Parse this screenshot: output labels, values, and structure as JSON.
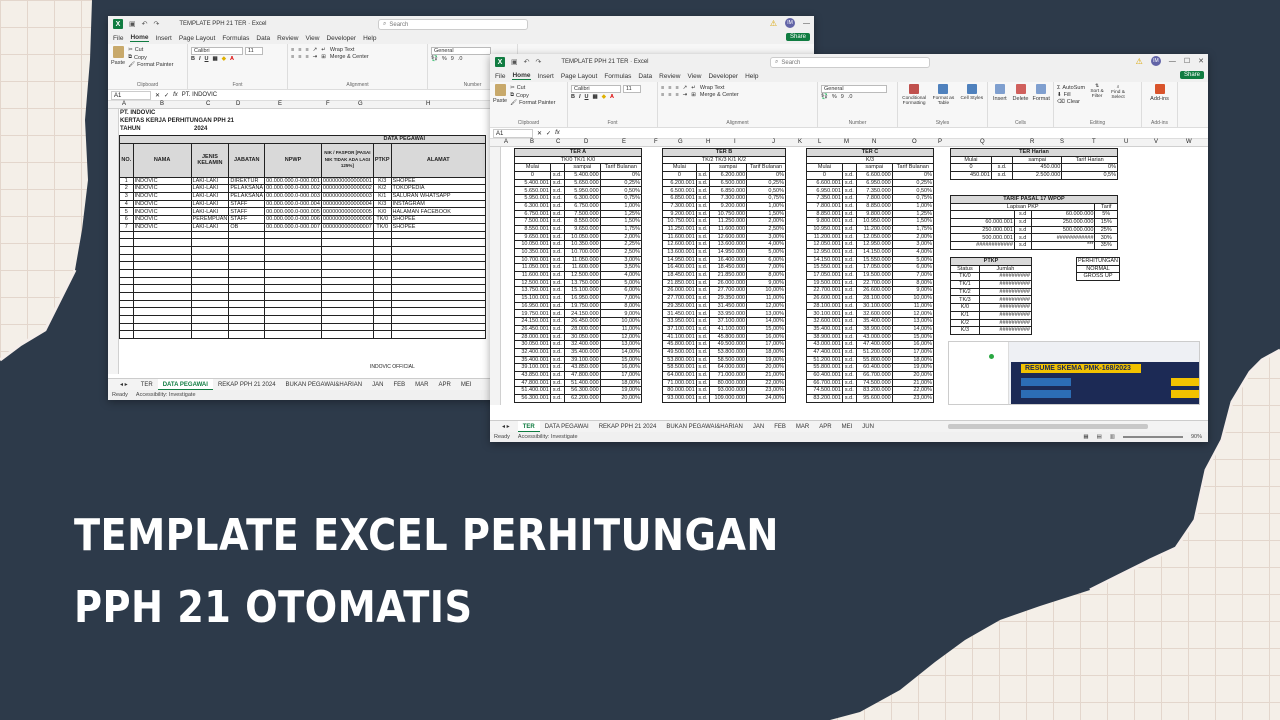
{
  "headline": {
    "line1": "TEMPLATE EXCEL PERHITUNGAN",
    "line2": "PPH 21 OTOMATIS"
  },
  "back_window": {
    "title": "TEMPLATE PPH 21 TER  ·  Excel",
    "search_placeholder": "Search",
    "menu": [
      "File",
      "Home",
      "Insert",
      "Page Layout",
      "Formulas",
      "Data",
      "Review",
      "View",
      "Developer",
      "Help"
    ],
    "share": "Share",
    "font_name": "Calibri",
    "font_size": "11",
    "number_format": "General",
    "clipboard": {
      "cut": "Cut",
      "copy": "Copy",
      "format_painter": "Format Painter",
      "paste": "Paste",
      "label": "Clipboard"
    },
    "wrap_text": "Wrap Text",
    "merge_center": "Merge & Center",
    "group_font": "Font",
    "group_alignment": "Alignment",
    "group_number": "Number",
    "name_box": "A1",
    "formula": "PT. INDOVIC",
    "cols": [
      "A",
      "B",
      "C",
      "D",
      "E",
      "F",
      "G",
      "H"
    ],
    "company": "PT. INDOVIC",
    "sheet_title": "KERTAS KERJA PERHITUNGAN PPH 21",
    "tahun_label": "TAHUN",
    "tahun_value": "2024",
    "data_pegawai": "DATA PEGAWAI",
    "headers": [
      "NO.",
      "NAMA",
      "JENIS KELAMIN",
      "JABATAN",
      "NPWP",
      "NIK / PASPOR [PASAI NIK TIDAK ADA LAGI 125%]",
      "PTKP",
      "ALAMAT"
    ],
    "rows": [
      [
        "1",
        "INDOVIC",
        "LAKI-LAKI",
        "DIREKTUR",
        "00.000.000.0-000.001",
        "0000000000000001",
        "K/3",
        "SHOPEE"
      ],
      [
        "2",
        "INDOVIC",
        "LAKI-LAKI",
        "PELAKSANA",
        "00.000.000.0-000.002",
        "0000000000000002",
        "K/2",
        "TOKOPEDIA"
      ],
      [
        "3",
        "INDOVIC",
        "LAKI-LAKI",
        "PELAKSANA",
        "00.000.000.0-000.003",
        "0000000000000003",
        "K/1",
        "SALURAN WHATSAPP"
      ],
      [
        "4",
        "INDOVIC",
        "LAKI-LAKI",
        "STAFF",
        "00.000.000.0-000.004",
        "0000000000000004",
        "K/3",
        "INSTAGRAM"
      ],
      [
        "5",
        "INDOVIC",
        "LAKI-LAKI",
        "STAFF",
        "00.000.000.0-000.005",
        "0000000000000005",
        "K/0",
        "HALAMAN FACEBOOK"
      ],
      [
        "6",
        "INDOVIC",
        "PEREMPUAN",
        "STAFF",
        "00.000.000.0-000.006",
        "0000000000000006",
        "TK/0",
        "SHOPEE"
      ],
      [
        "7",
        "INDOVIC",
        "LAKI-LAKI",
        "OB",
        "00.000.000.0-000.007",
        "0000000000000007",
        "TK/0",
        "SHOPEE"
      ]
    ],
    "footer_text": "INDOVIC OFFICIAL",
    "tabs": [
      "TER",
      "DATA PEGAWAI",
      "REKAP PPH 21 2024",
      "BUKAN PEGAWAI&HARIAN",
      "JAN",
      "FEB",
      "MAR",
      "APR",
      "MEI"
    ],
    "status_ready": "Ready",
    "status_access": "Accessibility: Investigate"
  },
  "front_window": {
    "title": "TEMPLATE PPH 21 TER  ·  Excel",
    "search_placeholder": "Search",
    "menu": [
      "File",
      "Home",
      "Insert",
      "Page Layout",
      "Formulas",
      "Data",
      "Review",
      "View",
      "Developer",
      "Help"
    ],
    "share": "Share",
    "font_name": "Calibri",
    "font_size": "11",
    "number_format": "General",
    "clipboard": {
      "cut": "Cut",
      "copy": "Copy",
      "format_painter": "Format Painter",
      "paste": "Paste",
      "label": "Clipboard"
    },
    "wrap_text": "Wrap Text",
    "merge_center": "Merge & Center",
    "styles": {
      "conditional": "Conditional Formatting",
      "format_table": "Format as Table",
      "cell_styles": "Cell Styles",
      "label": "Styles"
    },
    "cells": {
      "insert": "Insert",
      "delete": "Delete",
      "format": "Format",
      "label": "Cells"
    },
    "editing": {
      "autosum": "AutoSum",
      "fill": "Fill",
      "clear": "Clear",
      "sort": "Sort & Filter",
      "find": "Find & Select",
      "label": "Editing"
    },
    "addins": {
      "label": "Add-ins",
      "btn": "Add-ins"
    },
    "group_font": "Font",
    "group_alignment": "Alignment",
    "group_number": "Number",
    "name_box": "A1",
    "formula": "",
    "cols": [
      "A",
      "B",
      "C",
      "D",
      "E",
      "F",
      "G",
      "H",
      "I",
      "J",
      "K",
      "L",
      "M",
      "N",
      "O",
      "P",
      "Q",
      "R",
      "S",
      "T",
      "U",
      "V",
      "W"
    ],
    "ter_a": {
      "title": "TER A",
      "sub": "TK/0  TK/1  K/0",
      "h": [
        "Mulai",
        "",
        "sampai",
        "Tarif Bulanan"
      ],
      "rows": [
        [
          "0",
          "s.d.",
          "5.400.000",
          "0%"
        ],
        [
          "5.400.001",
          "s.d.",
          "5.650.000",
          "0,25%"
        ],
        [
          "5.650.001",
          "s.d.",
          "5.950.000",
          "0,50%"
        ],
        [
          "5.950.001",
          "s.d.",
          "6.300.000",
          "0,75%"
        ],
        [
          "6.300.001",
          "s.d.",
          "6.750.000",
          "1,00%"
        ],
        [
          "6.750.001",
          "s.d.",
          "7.500.000",
          "1,25%"
        ],
        [
          "7.500.001",
          "s.d.",
          "8.550.000",
          "1,50%"
        ],
        [
          "8.550.001",
          "s.d.",
          "9.650.000",
          "1,75%"
        ],
        [
          "9.650.001",
          "s.d.",
          "10.050.000",
          "2,00%"
        ],
        [
          "10.050.001",
          "s.d.",
          "10.350.000",
          "2,25%"
        ],
        [
          "10.350.001",
          "s.d.",
          "10.700.000",
          "2,50%"
        ],
        [
          "10.700.001",
          "s.d.",
          "11.050.000",
          "3,00%"
        ],
        [
          "11.050.001",
          "s.d.",
          "11.600.000",
          "3,50%"
        ],
        [
          "11.600.001",
          "s.d.",
          "12.500.000",
          "4,00%"
        ],
        [
          "12.500.001",
          "s.d.",
          "13.750.000",
          "5,00%"
        ],
        [
          "13.750.001",
          "s.d.",
          "15.100.000",
          "6,00%"
        ],
        [
          "15.100.001",
          "s.d.",
          "16.950.000",
          "7,00%"
        ],
        [
          "16.950.001",
          "s.d.",
          "19.750.000",
          "8,00%"
        ],
        [
          "19.750.001",
          "s.d.",
          "24.150.000",
          "9,00%"
        ],
        [
          "24.150.001",
          "s.d.",
          "26.450.000",
          "10,00%"
        ],
        [
          "26.450.001",
          "s.d.",
          "28.000.000",
          "11,00%"
        ],
        [
          "28.000.001",
          "s.d.",
          "30.050.000",
          "12,00%"
        ],
        [
          "30.050.001",
          "s.d.",
          "32.400.000",
          "13,00%"
        ],
        [
          "32.400.001",
          "s.d.",
          "35.400.000",
          "14,00%"
        ],
        [
          "35.400.001",
          "s.d.",
          "39.100.000",
          "15,00%"
        ],
        [
          "39.100.001",
          "s.d.",
          "43.850.000",
          "16,00%"
        ],
        [
          "43.850.001",
          "s.d.",
          "47.800.000",
          "17,00%"
        ],
        [
          "47.800.001",
          "s.d.",
          "51.400.000",
          "18,00%"
        ],
        [
          "51.400.001",
          "s.d.",
          "56.300.000",
          "19,00%"
        ],
        [
          "56.300.001",
          "s.d.",
          "62.200.000",
          "20,00%"
        ]
      ]
    },
    "ter_b": {
      "title": "TER B",
      "sub": "TK/2  TK/3  K/1  K/2",
      "h": [
        "Mulai",
        "",
        "sampai",
        "Tarif Bulanan"
      ],
      "rows": [
        [
          "0",
          "s.d.",
          "6.200.000",
          "0%"
        ],
        [
          "6.200.001",
          "s.d.",
          "6.500.000",
          "0,25%"
        ],
        [
          "6.500.001",
          "s.d.",
          "6.850.000",
          "0,50%"
        ],
        [
          "6.850.001",
          "s.d.",
          "7.300.000",
          "0,75%"
        ],
        [
          "7.300.001",
          "s.d.",
          "9.200.000",
          "1,00%"
        ],
        [
          "9.200.001",
          "s.d.",
          "10.750.000",
          "1,50%"
        ],
        [
          "10.750.001",
          "s.d.",
          "11.250.000",
          "2,00%"
        ],
        [
          "11.250.001",
          "s.d.",
          "11.600.000",
          "2,50%"
        ],
        [
          "11.600.001",
          "s.d.",
          "12.600.000",
          "3,00%"
        ],
        [
          "12.600.001",
          "s.d.",
          "13.600.000",
          "4,00%"
        ],
        [
          "13.600.001",
          "s.d.",
          "14.950.000",
          "5,00%"
        ],
        [
          "14.950.001",
          "s.d.",
          "16.400.000",
          "6,00%"
        ],
        [
          "16.400.001",
          "s.d.",
          "18.450.000",
          "7,00%"
        ],
        [
          "18.450.001",
          "s.d.",
          "21.850.000",
          "8,00%"
        ],
        [
          "21.850.001",
          "s.d.",
          "26.000.000",
          "9,00%"
        ],
        [
          "26.000.001",
          "s.d.",
          "27.700.000",
          "10,00%"
        ],
        [
          "27.700.001",
          "s.d.",
          "29.350.000",
          "11,00%"
        ],
        [
          "29.350.001",
          "s.d.",
          "31.450.000",
          "12,00%"
        ],
        [
          "31.450.001",
          "s.d.",
          "33.950.000",
          "13,00%"
        ],
        [
          "33.950.001",
          "s.d.",
          "37.100.000",
          "14,00%"
        ],
        [
          "37.100.001",
          "s.d.",
          "41.100.000",
          "15,00%"
        ],
        [
          "41.100.001",
          "s.d.",
          "45.800.000",
          "16,00%"
        ],
        [
          "45.800.001",
          "s.d.",
          "49.500.000",
          "17,00%"
        ],
        [
          "49.500.001",
          "s.d.",
          "53.800.000",
          "18,00%"
        ],
        [
          "53.800.001",
          "s.d.",
          "58.500.000",
          "19,00%"
        ],
        [
          "58.500.001",
          "s.d.",
          "64.000.000",
          "20,00%"
        ],
        [
          "64.000.001",
          "s.d.",
          "71.000.000",
          "21,00%"
        ],
        [
          "71.000.001",
          "s.d.",
          "80.000.000",
          "22,00%"
        ],
        [
          "80.000.001",
          "s.d.",
          "93.000.000",
          "23,00%"
        ],
        [
          "93.000.001",
          "s.d.",
          "109.000.000",
          "24,00%"
        ]
      ]
    },
    "ter_c": {
      "title": "TER C",
      "sub": "K/3",
      "h": [
        "Mulai",
        "",
        "sampai",
        "Tarif Bulanan"
      ],
      "rows": [
        [
          "0",
          "s.d.",
          "6.600.000",
          "0%"
        ],
        [
          "6.600.001",
          "s.d.",
          "6.950.000",
          "0,25%"
        ],
        [
          "6.950.001",
          "s.d.",
          "7.350.000",
          "0,50%"
        ],
        [
          "7.350.001",
          "s.d.",
          "7.800.000",
          "0,75%"
        ],
        [
          "7.800.001",
          "s.d.",
          "8.850.000",
          "1,00%"
        ],
        [
          "8.850.001",
          "s.d.",
          "9.800.000",
          "1,25%"
        ],
        [
          "9.800.001",
          "s.d.",
          "10.950.000",
          "1,50%"
        ],
        [
          "10.950.001",
          "s.d.",
          "11.200.000",
          "1,75%"
        ],
        [
          "11.200.001",
          "s.d.",
          "12.050.000",
          "2,00%"
        ],
        [
          "12.050.001",
          "s.d.",
          "12.950.000",
          "3,00%"
        ],
        [
          "12.950.001",
          "s.d.",
          "14.150.000",
          "4,00%"
        ],
        [
          "14.150.001",
          "s.d.",
          "15.550.000",
          "5,00%"
        ],
        [
          "15.550.001",
          "s.d.",
          "17.050.000",
          "6,00%"
        ],
        [
          "17.050.001",
          "s.d.",
          "19.500.000",
          "7,00%"
        ],
        [
          "19.500.001",
          "s.d.",
          "22.700.000",
          "8,00%"
        ],
        [
          "22.700.001",
          "s.d.",
          "26.600.000",
          "9,00%"
        ],
        [
          "26.600.001",
          "s.d.",
          "28.100.000",
          "10,00%"
        ],
        [
          "28.100.001",
          "s.d.",
          "30.100.000",
          "11,00%"
        ],
        [
          "30.100.001",
          "s.d.",
          "32.600.000",
          "12,00%"
        ],
        [
          "32.600.001",
          "s.d.",
          "35.400.000",
          "13,00%"
        ],
        [
          "35.400.001",
          "s.d.",
          "38.900.000",
          "14,00%"
        ],
        [
          "38.900.001",
          "s.d.",
          "43.000.000",
          "15,00%"
        ],
        [
          "43.000.001",
          "s.d.",
          "47.400.000",
          "16,00%"
        ],
        [
          "47.400.001",
          "s.d.",
          "51.200.000",
          "17,00%"
        ],
        [
          "51.200.001",
          "s.d.",
          "55.800.000",
          "18,00%"
        ],
        [
          "55.800.001",
          "s.d.",
          "60.400.000",
          "19,00%"
        ],
        [
          "60.400.001",
          "s.d.",
          "66.700.000",
          "20,00%"
        ],
        [
          "66.700.001",
          "s.d.",
          "74.500.000",
          "21,00%"
        ],
        [
          "74.500.001",
          "s.d.",
          "83.200.000",
          "22,00%"
        ],
        [
          "83.200.001",
          "s.d.",
          "95.600.000",
          "23,00%"
        ]
      ]
    },
    "ter_harian": {
      "title": "TER Harian",
      "h": [
        "Mulai",
        "",
        "sampai",
        "Tarif Harian"
      ],
      "rows": [
        [
          "0",
          "s.d.",
          "450.000",
          "0%"
        ],
        [
          "450.001",
          "s.d.",
          "2.500.000",
          "0,5%"
        ]
      ]
    },
    "pasal17": {
      "title": "TARIF PASAL 17 WPOP",
      "h1": "Lapisan PKP",
      "h2": "Tarif",
      "rows": [
        [
          "",
          "s.d",
          "60.000.000",
          "5%"
        ],
        [
          "60.000.001",
          "s.d",
          "250.000.000",
          "15%"
        ],
        [
          "250.000.001",
          "s.d",
          "500.000.000",
          "25%"
        ],
        [
          "500.000.001",
          "s.d",
          "############",
          "30%"
        ],
        [
          "############",
          "s.d",
          "***",
          "35%"
        ]
      ]
    },
    "ptkp": {
      "title": "PTKP",
      "h": [
        "Status",
        "Jumlah"
      ],
      "rows": [
        [
          "TK/0",
          "##########"
        ],
        [
          "TK/1",
          "##########"
        ],
        [
          "TK/2",
          "##########"
        ],
        [
          "TK/3",
          "##########"
        ],
        [
          "K/0",
          "##########"
        ],
        [
          "K/1",
          "##########"
        ],
        [
          "K/2",
          "##########"
        ],
        [
          "K/3",
          "##########"
        ]
      ]
    },
    "perhitungan": {
      "title": "PERHITUNGAN",
      "rows": [
        "NORMAL",
        "GROSS UP"
      ]
    },
    "resume": "RESUME SKEMA PMK-168/2023",
    "tabs": [
      "TER",
      "DATA PEGAWAI",
      "REKAP PPH 21 2024",
      "BUKAN PEGAWAI&HARIAN",
      "JAN",
      "FEB",
      "MAR",
      "APR",
      "MEI",
      "JUN"
    ],
    "status_ready": "Ready",
    "status_access": "Accessibility: Investigate",
    "zoom": "90%"
  },
  "colors": {
    "excel_green": "#107c41",
    "dark_bg": "#2c3a4b",
    "paper": "#f4efe8"
  }
}
